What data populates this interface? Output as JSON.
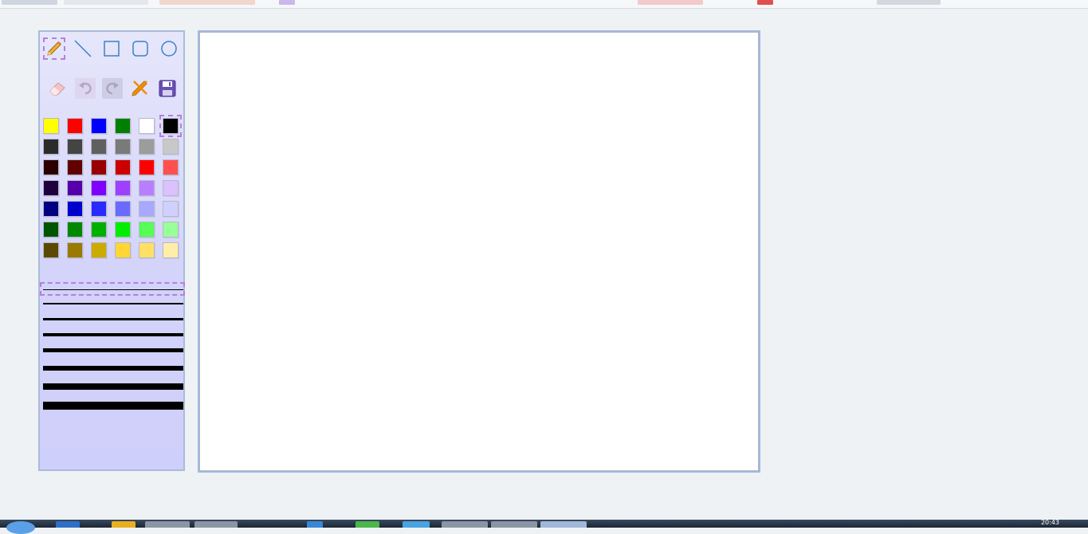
{
  "tools": {
    "row1": [
      {
        "name": "pencil",
        "selected": true
      },
      {
        "name": "line"
      },
      {
        "name": "rectangle"
      },
      {
        "name": "rounded-rectangle"
      },
      {
        "name": "ellipse"
      }
    ],
    "row2": [
      {
        "name": "eraser"
      },
      {
        "name": "undo",
        "disabled": true
      },
      {
        "name": "redo",
        "disabled": true
      },
      {
        "name": "clear"
      },
      {
        "name": "save"
      }
    ]
  },
  "palette": {
    "selected": "#000000",
    "rows": [
      [
        "#ffff00",
        "#ff0000",
        "#0000ff",
        "#008000",
        "#ffffff",
        "#000000"
      ],
      [
        "#2b2b2b",
        "#444444",
        "#5f5f5f",
        "#7a7a7a",
        "#9c9c9c",
        "#c8c8c8"
      ],
      [
        "#2a0000",
        "#600000",
        "#990000",
        "#cc0000",
        "#ff0000",
        "#ff5050"
      ],
      [
        "#1f003f",
        "#5500aa",
        "#7f00ff",
        "#9f3fff",
        "#b77fff",
        "#dcc0ff"
      ],
      [
        "#000080",
        "#0000cc",
        "#2a2aff",
        "#6a6aff",
        "#a8a8ff",
        "#d0d0ff"
      ],
      [
        "#005500",
        "#008800",
        "#00b000",
        "#00ee00",
        "#55ff55",
        "#99ff99"
      ],
      [
        "#5a4a00",
        "#9a7a00",
        "#ccaa00",
        "#ffd633",
        "#ffe066",
        "#ffeea8"
      ]
    ]
  },
  "line_widths": [
    1,
    2,
    3,
    4,
    5,
    6,
    8,
    10
  ],
  "selected_line_width": 1,
  "taskbar": {
    "clock": "20:43"
  }
}
